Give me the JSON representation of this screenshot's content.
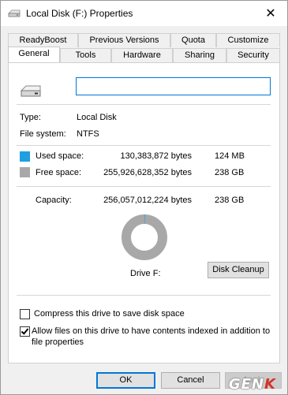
{
  "window": {
    "title": "Local Disk (F:) Properties",
    "close_glyph": "✕"
  },
  "tabs": {
    "row1": [
      "ReadyBoost",
      "Previous Versions",
      "Quota",
      "Customize"
    ],
    "row2": [
      "General",
      "Tools",
      "Hardware",
      "Sharing",
      "Security"
    ],
    "active": "General"
  },
  "general": {
    "name_value": "",
    "type_label": "Type:",
    "type_value": "Local Disk",
    "fs_label": "File system:",
    "fs_value": "NTFS",
    "used_label": "Used space:",
    "used_bytes": "130,383,872 bytes",
    "used_size": "124 MB",
    "free_label": "Free space:",
    "free_bytes": "255,926,628,352 bytes",
    "free_size": "238 GB",
    "capacity_label": "Capacity:",
    "capacity_bytes": "256,057,012,224 bytes",
    "capacity_size": "238 GB",
    "drive_label": "Drive F:",
    "cleanup_label": "Disk Cleanup",
    "used_fraction": 0.0005,
    "compress_label": "Compress this drive to save disk space",
    "compress_checked": false,
    "index_label_line1": "Allow files on this drive to have contents indexed in addition to",
    "index_label_line2": "file properties",
    "index_checked": true
  },
  "buttons": {
    "ok": "OK",
    "cancel": "Cancel",
    "apply": "Apply"
  },
  "watermark": {
    "text_main": "GEN",
    "text_accent": "K"
  },
  "colors": {
    "used": "#1e9fe0",
    "free": "#a8a8a8",
    "accent": "#0078d7"
  }
}
